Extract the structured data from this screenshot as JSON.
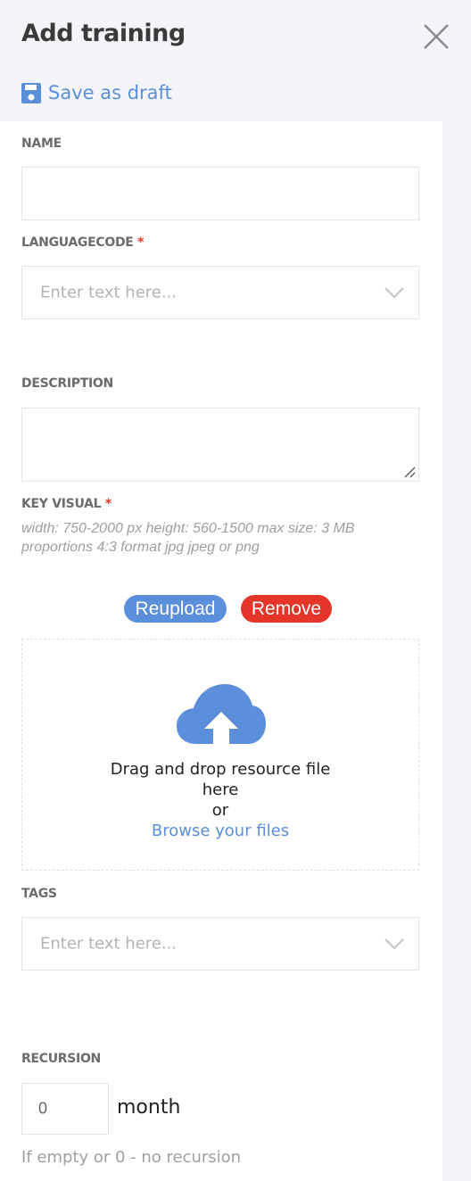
{
  "header": {
    "title": "Add training",
    "save_draft_label": "Save as draft"
  },
  "form": {
    "name": {
      "label": "NAME",
      "value": ""
    },
    "languagecode": {
      "label": "LANGUAGECODE",
      "required_mark": "*",
      "placeholder": "Enter text here..."
    },
    "description": {
      "label": "DESCRIPTION",
      "value": ""
    },
    "key_visual": {
      "label": "KEY VISUAL",
      "required_mark": "*",
      "hint": "width: 750-2000 px height: 560-1500 max size: 3 MB proportions 4:3 format jpg jpeg or png",
      "reupload_label": "Reupload",
      "remove_label": "Remove",
      "dropzone": {
        "line1": "Drag and drop resource file here",
        "line2": "or",
        "browse_label": "Browse your files"
      }
    },
    "tags": {
      "label": "TAGS",
      "placeholder": "Enter text here..."
    },
    "recursion": {
      "label": "RECURSION",
      "value": "0",
      "unit": "month",
      "note": "If empty or 0 - no recursion"
    }
  },
  "colors": {
    "accent": "#5b8fdc",
    "danger": "#e53528",
    "background": "#f4f5f9"
  }
}
